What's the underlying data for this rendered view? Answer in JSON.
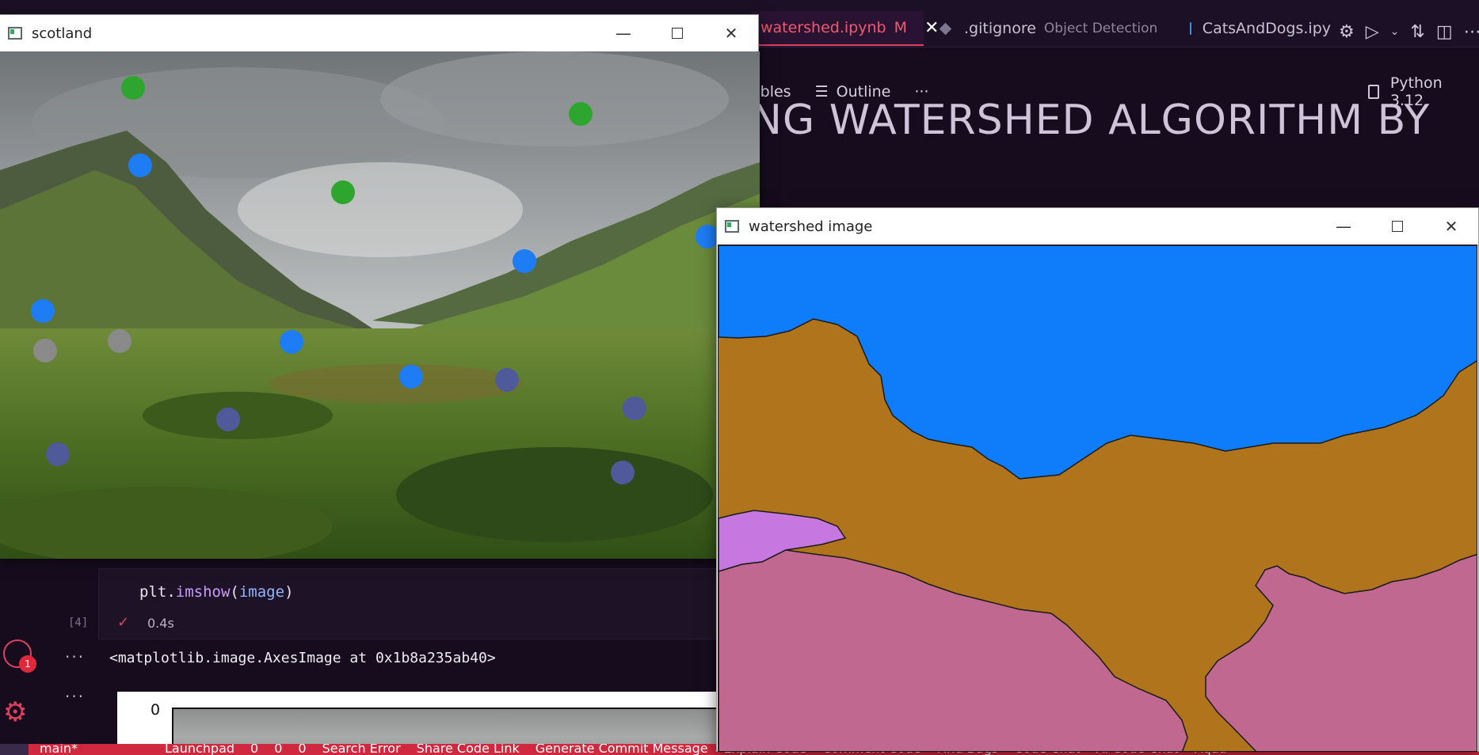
{
  "editor": {
    "tabs": [
      {
        "label": "watershed.ipynb",
        "modified": "M"
      },
      {
        "label": ".gitignore",
        "detail": "Object Detection"
      },
      {
        "label": "CatsAndDogs.ipy"
      }
    ],
    "toolbar": {
      "variables": "ables",
      "outline": "Outline",
      "more": "···"
    },
    "kernel": "Python 3.12",
    "heading": "NG WATERSHED ALGORITHM BY",
    "cell": {
      "code_obj": "plt.",
      "code_fn": "imshow",
      "code_arg": "image",
      "exec_count": "[4]",
      "exec_time": "0.4s",
      "output": "<matplotlib.image.AxesImage at 0x1b8a235ab40>",
      "plot_ytick": "0"
    },
    "account_badge": "1",
    "more_dots": "···"
  },
  "status_bar": {
    "items": [
      "main*",
      "Launchpad",
      "0",
      "0",
      "0",
      "Search Error",
      "Share Code Link",
      "Generate Commit Message",
      "Explain Code",
      "Comment Code",
      "Find Bugs",
      "Code Chat",
      "AI Code Chat",
      "Aqua"
    ]
  },
  "windows": {
    "scotland": {
      "title": "scotland"
    },
    "watershed": {
      "title": "watershed image"
    }
  },
  "colors": {
    "accent": "#e04060",
    "marker_green": "#2ea52e",
    "marker_blue": "#1e7cf4",
    "marker_gray": "#8a8a8a",
    "marker_slate": "#4f5a9a",
    "region_sky": "#0f7dfa",
    "region_valley": "#b0741d",
    "region_left": "#c678e0",
    "region_bottom": "#c06890"
  }
}
